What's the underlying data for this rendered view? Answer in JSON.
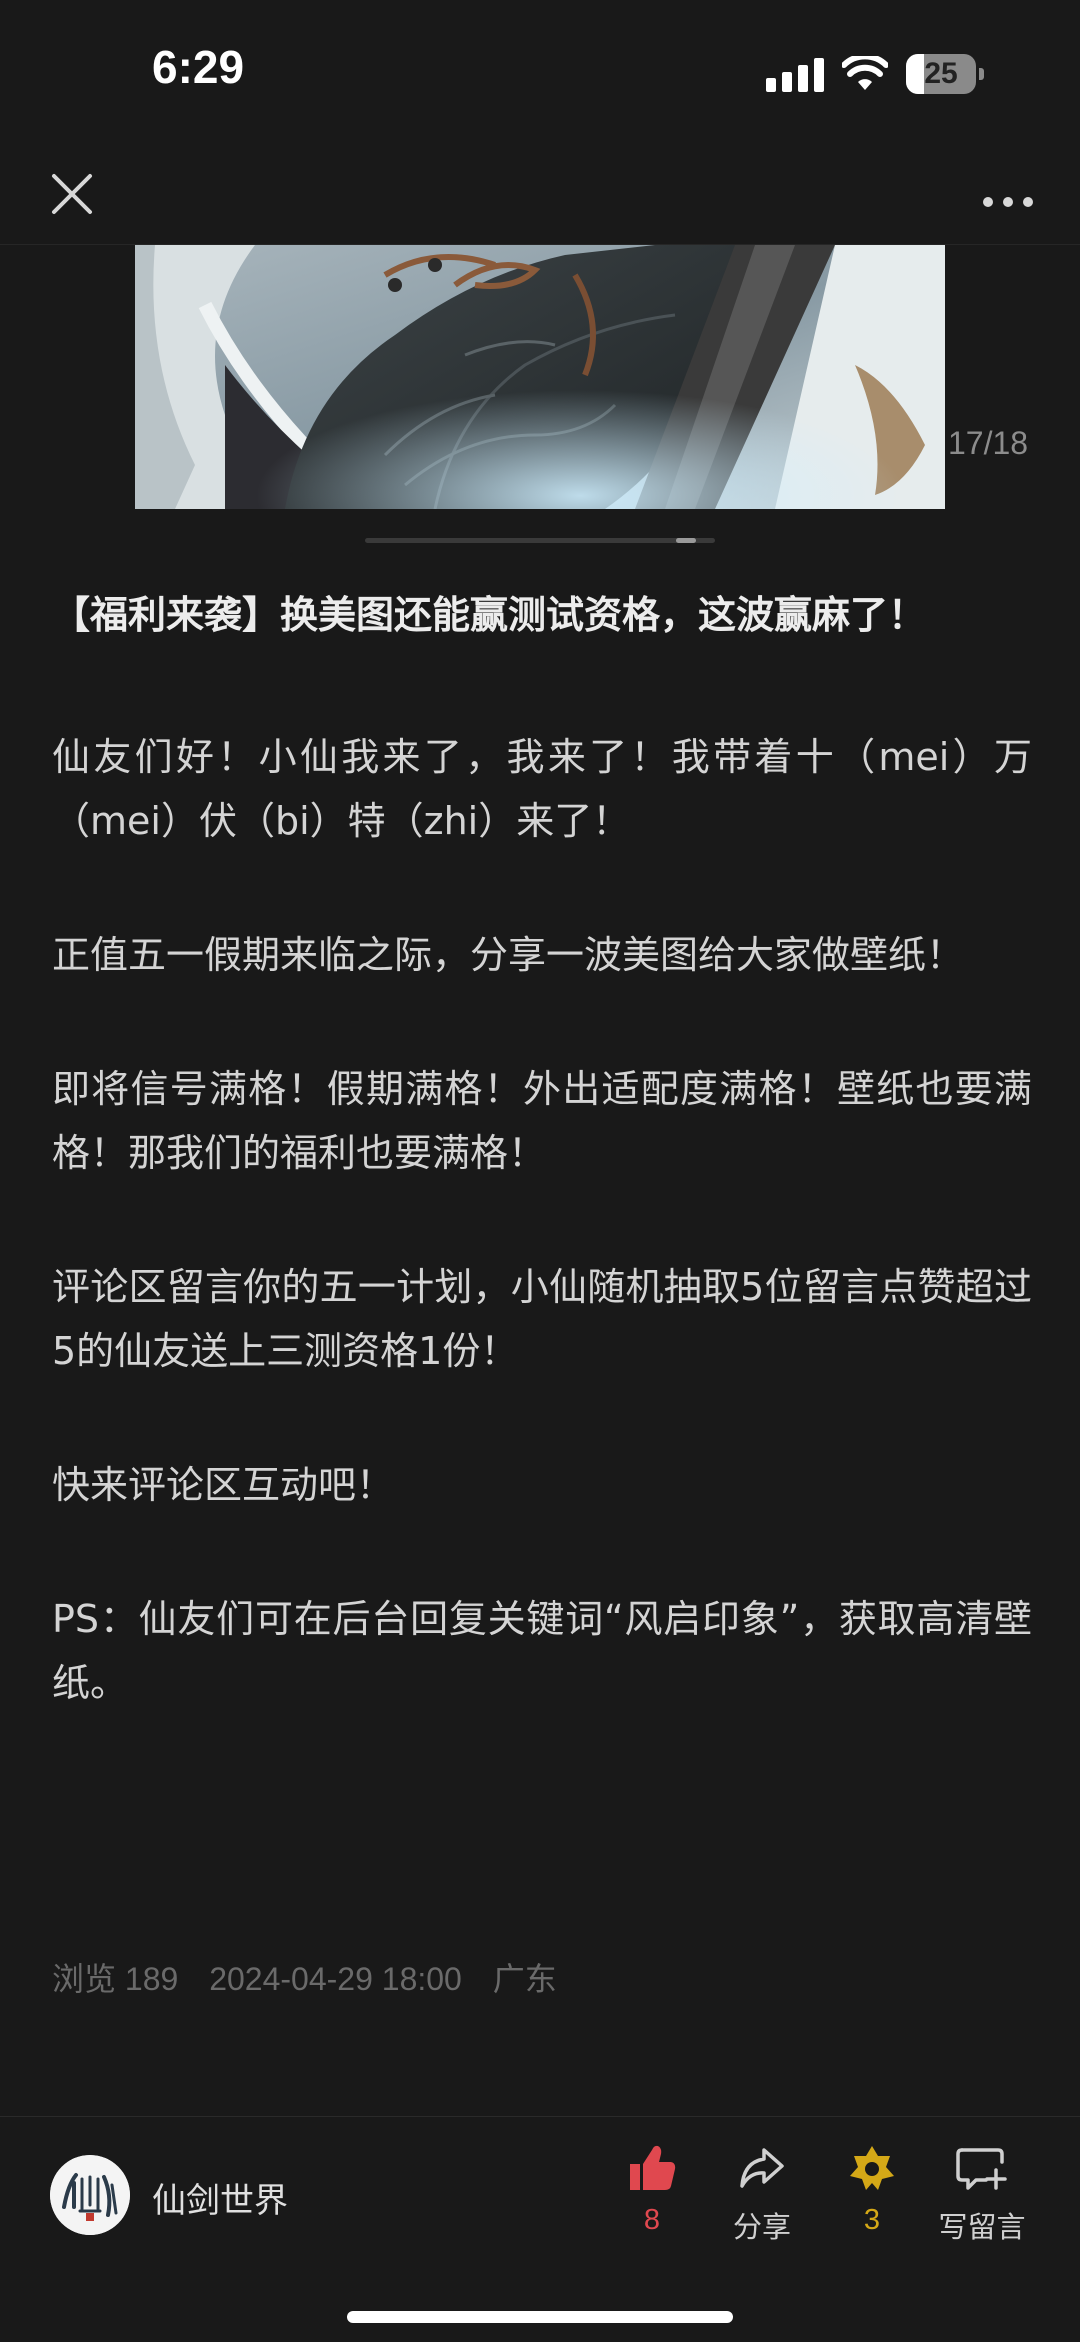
{
  "status_bar": {
    "time": "6:29",
    "battery_level": "25"
  },
  "nav": {
    "close_icon": "close-icon",
    "more_icon": "more-dots-icon"
  },
  "carousel": {
    "counter": "17/18",
    "current_index": 17,
    "total": 18
  },
  "article": {
    "title": "【福利来袭】换美图还能赢测试资格，这波赢麻了！",
    "paragraphs": [
      "仙友们好！小仙我来了，我来了！我带着十（mei）万（mei）伏（bi）特（zhi）来了！",
      "正值五一假期来临之际，分享一波美图给大家做壁纸！",
      "即将信号满格！假期满格！外出适配度满格！壁纸也要满格！那我们的福利也要满格！",
      "评论区留言你的五一计划，小仙随机抽取5位留言点赞超过5的仙友送上三测资格1份！",
      "快来评论区互动吧！",
      "PS：仙友们可在后台回复关键词“风启印象”，获取高清壁纸。"
    ],
    "meta": {
      "views": "浏览 189",
      "datetime": "2024-04-29 18:00",
      "location": "广东"
    }
  },
  "bottom_bar": {
    "author_name": "仙剑世界",
    "like_count": "8",
    "share_label": "分享",
    "favorite_count": "3",
    "comment_label": "写留言"
  },
  "colors": {
    "background": "#191919",
    "like": "#e0484f",
    "favorite": "#d4a817"
  }
}
